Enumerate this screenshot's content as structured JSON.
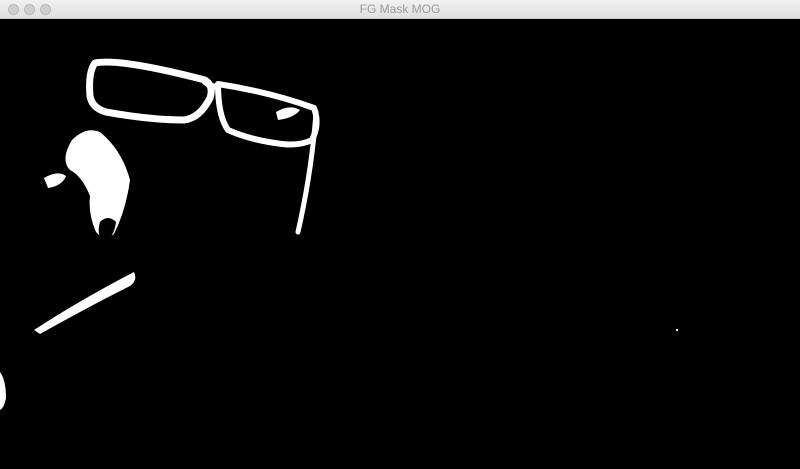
{
  "window": {
    "title": "FG Mask MOG"
  },
  "colors": {
    "background": "#000000",
    "foreground": "#ffffff",
    "titlebar": "#e6e6e6",
    "title_text": "#9a9a9a"
  }
}
